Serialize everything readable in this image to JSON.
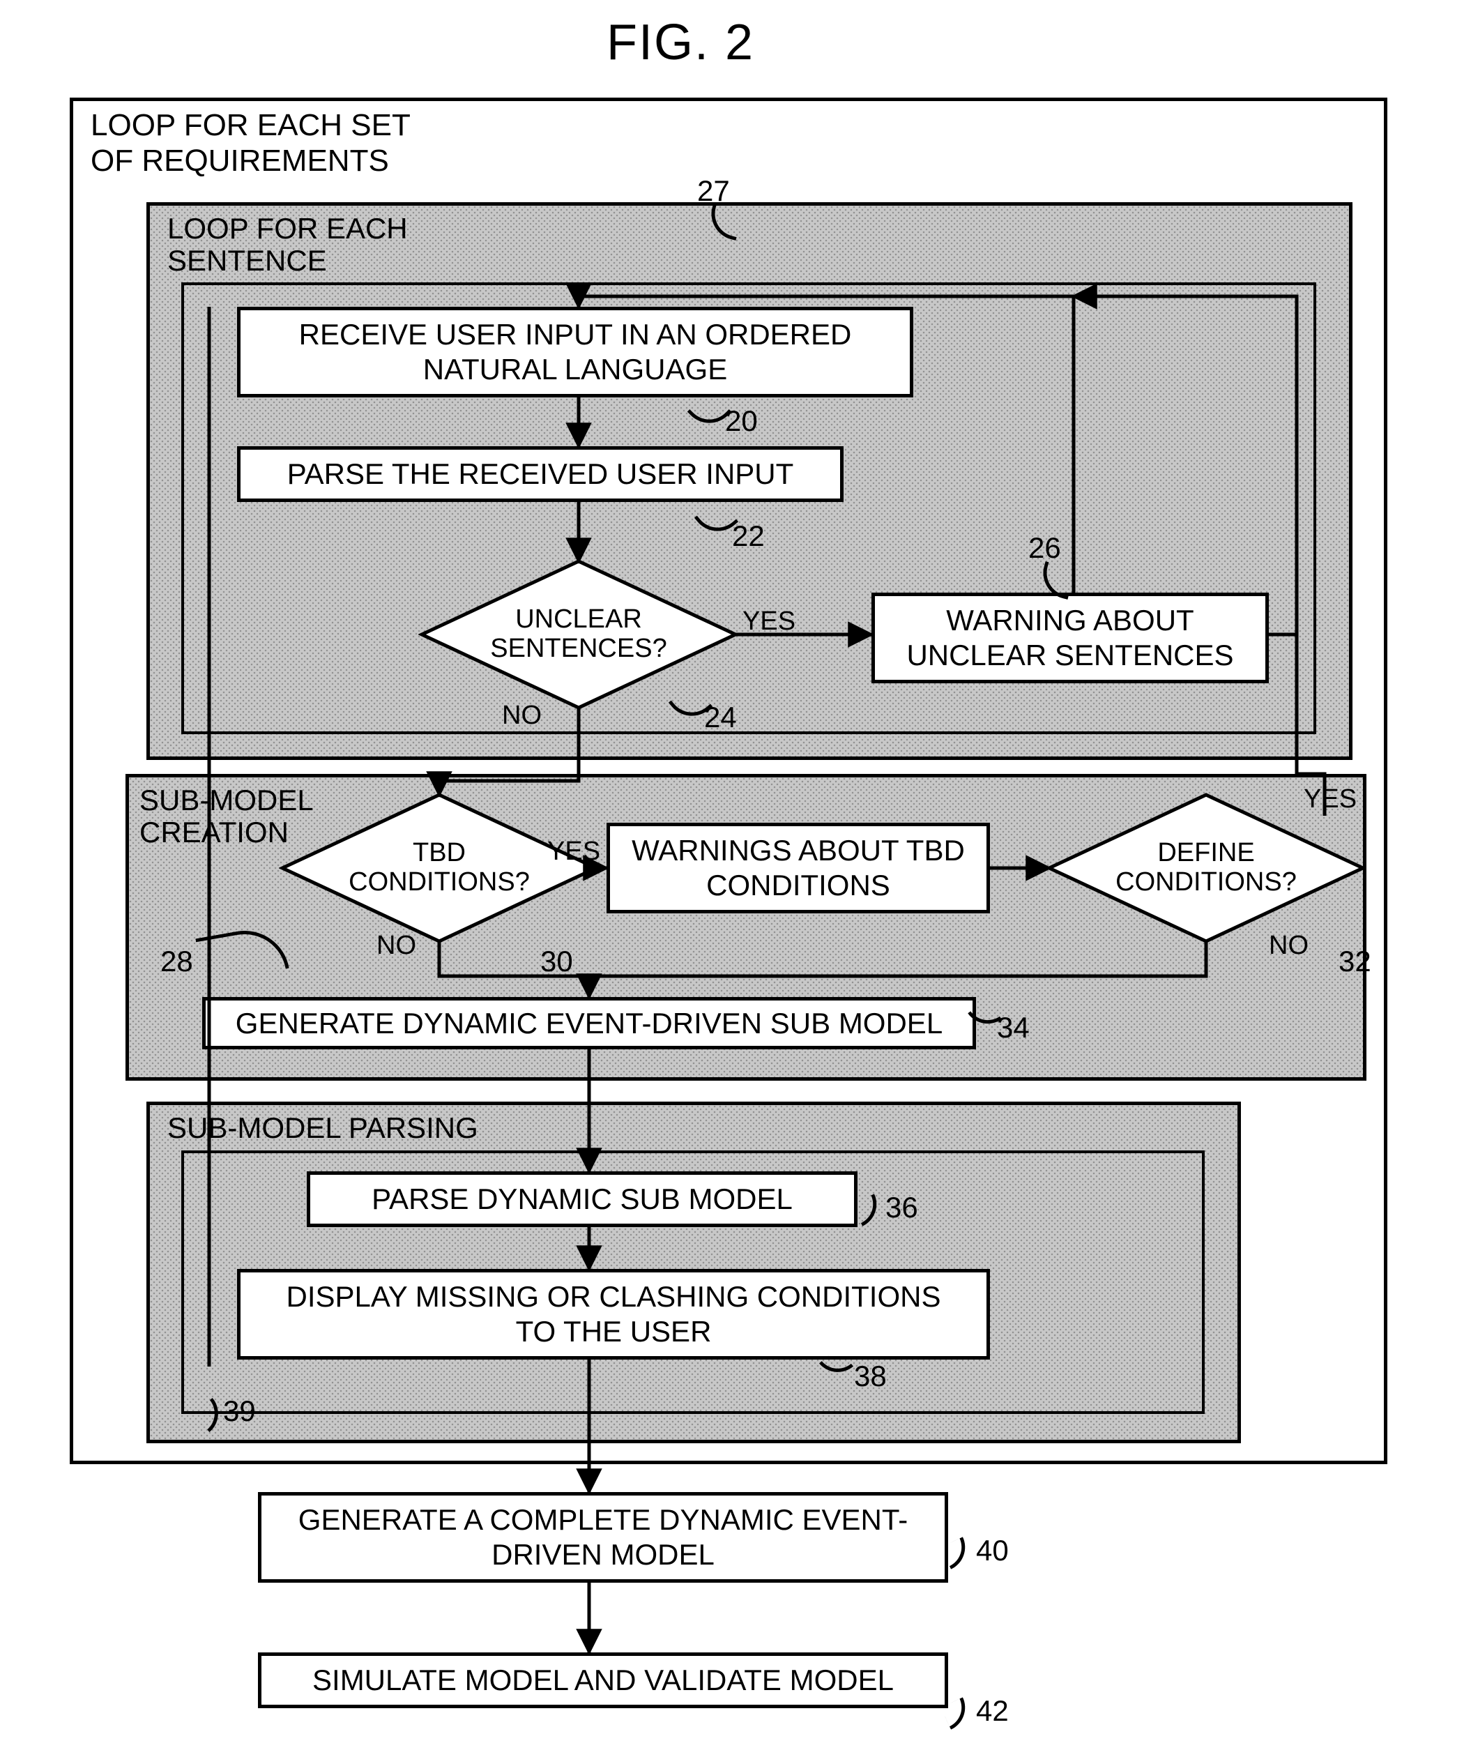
{
  "figure_title": "FIG. 2",
  "outer": {
    "label": "LOOP FOR EACH SET\nOF REQUIREMENTS"
  },
  "loop_sentence": {
    "label": "LOOP FOR EACH\nSENTENCE",
    "ref": "27"
  },
  "sub_model_creation": {
    "label": "SUB-MODEL\nCREATION"
  },
  "sub_model_parsing": {
    "label": "SUB-MODEL PARSING",
    "ref": "39"
  },
  "boxes": {
    "receive": {
      "text": "RECEIVE USER INPUT IN AN ORDERED\nNATURAL LANGUAGE",
      "ref": "20"
    },
    "parse_input": {
      "text": "PARSE THE RECEIVED USER INPUT",
      "ref": "22"
    },
    "warning_unclear": {
      "text": "WARNING ABOUT\nUNCLEAR SENTENCES",
      "ref": "26"
    },
    "warnings_tbd": {
      "text": "WARNINGS ABOUT TBD\nCONDITIONS",
      "ref": "30"
    },
    "gen_sub": {
      "text": "GENERATE DYNAMIC EVENT-DRIVEN SUB MODEL",
      "ref": "34"
    },
    "parse_sub": {
      "text": "PARSE DYNAMIC SUB MODEL",
      "ref": "36"
    },
    "display_missing": {
      "text": "DISPLAY MISSING OR CLASHING CONDITIONS\nTO THE USER",
      "ref": "38"
    },
    "gen_complete": {
      "text": "GENERATE A COMPLETE DYNAMIC EVENT-\nDRIVEN MODEL",
      "ref": "40"
    },
    "simulate": {
      "text": "SIMULATE MODEL AND VALIDATE MODEL",
      "ref": "42"
    }
  },
  "decisions": {
    "unclear": {
      "text": "UNCLEAR\nSENTENCES?",
      "ref": "24",
      "yes": "YES",
      "no": "NO"
    },
    "tbd": {
      "text": "TBD\nCONDITIONS?",
      "ref": "28",
      "yes": "YES",
      "no": "NO"
    },
    "define": {
      "text": "DEFINE\nCONDITIONS?",
      "ref": "32",
      "yes": "YES",
      "no": "NO"
    }
  }
}
